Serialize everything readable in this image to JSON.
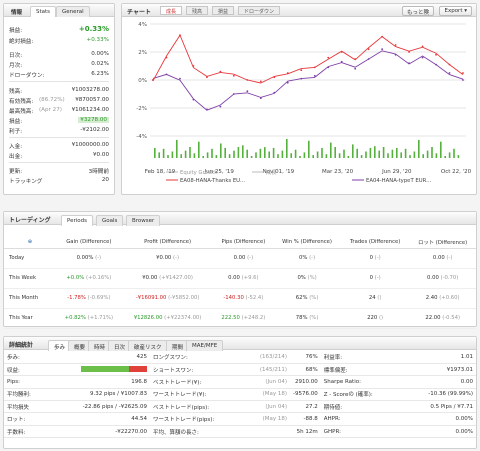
{
  "info": {
    "tabs": [
      "情報",
      "Stats",
      "General"
    ],
    "rows": [
      {
        "k": "損益:",
        "v": "+0.33%",
        "cls": "green big"
      },
      {
        "k": "絶対損益:",
        "v": "+0.33%",
        "cls": "green"
      },
      {
        "k": "日次:",
        "v": "0.00%"
      },
      {
        "k": "月次:",
        "v": "0.02%"
      },
      {
        "k": "ドローダウン:",
        "v": "6.23%"
      },
      {
        "k": "残高:",
        "v": "¥1003278.00"
      },
      {
        "k": "有効残高:",
        "sub": "(86.72%)",
        "v": "¥870057.00"
      },
      {
        "k": "最高残高:",
        "sub": "(Apr 27)",
        "v": "¥1061234.00"
      },
      {
        "k": "損益:",
        "v": "¥3278.00",
        "cls": "hl"
      },
      {
        "k": "利子:",
        "v": "-¥2102.00"
      },
      {
        "k": "入金:",
        "v": "¥1000000.00"
      },
      {
        "k": "出金:",
        "v": "¥0.00"
      },
      {
        "k": "更新:",
        "v": "3時間前"
      },
      {
        "k": "トラッキング",
        "v": "20"
      }
    ]
  },
  "chart": {
    "title": "チャート",
    "tabs": [
      "成長",
      "残高",
      "損益",
      "ドローダウン"
    ],
    "more": "もっと険",
    "export": "Export",
    "legend": [
      "Equity Growth",
      "成長",
      "EA08-HANA-Thanks EU...",
      "EA04-HANA-typeT EUR..."
    ],
    "colors": {
      "series1": "#7e3fa8",
      "series2": "#e8373a",
      "bars": "#55b03e"
    }
  },
  "chart_data": {
    "type": "line",
    "x": [
      "Feb 18, '19",
      "Jun 25, '19",
      "Nov 01, '19",
      "Mar 23, '20",
      "Jun 29, '20",
      "Oct 22, '20"
    ],
    "ylim": [
      -4,
      4
    ],
    "yticks": [
      "4%",
      "2%",
      "0%",
      "-2%",
      "-4%"
    ],
    "series": [
      {
        "name": "EA04-HANA-typeT EUR",
        "values": [
          0.0,
          0.4,
          0.1,
          -1.4,
          -2.1,
          -1.9,
          -1.0,
          -0.8,
          -1.3,
          -0.9,
          -0.2,
          0.1,
          0.3,
          0.9,
          1.3,
          0.8,
          1.5,
          2.2,
          1.8,
          1.2,
          1.6,
          1.1,
          0.5,
          0.0
        ]
      },
      {
        "name": "EA08-HANA-Thanks EU",
        "values": [
          0.0,
          1.6,
          3.2,
          1.0,
          0.2,
          0.6,
          0.3,
          0.0,
          -0.1,
          0.2,
          0.5,
          0.7,
          0.9,
          1.6,
          2.0,
          1.5,
          2.2,
          3.1,
          2.5,
          2.0,
          2.4,
          1.8,
          1.1,
          0.5
        ]
      }
    ]
  },
  "trading": {
    "title": "トレーディング",
    "tabs": [
      "Periods",
      "Goals",
      "Browser"
    ],
    "headers": [
      "Gain (Difference)",
      "Profit (Difference)",
      "Pips (Difference)",
      "Win % (Difference)",
      "Trades (Difference)",
      "ロット (Difference)"
    ],
    "rows": [
      {
        "name": "Today",
        "gain": "0.00%",
        "gain_d": "(-)",
        "profit": "¥0.00",
        "profit_d": "(-)",
        "pips": "0.00",
        "pips_d": "(-)",
        "win": "0%",
        "win_d": "(-)",
        "trades": "0",
        "trades_d": "(-)",
        "lots": "0.00",
        "lots_d": "(-)"
      },
      {
        "name": "This Week",
        "gain": "+0.0%",
        "gain_d": "(+0.16%)",
        "profit": "¥0.00",
        "profit_d": "(+¥1427.00)",
        "pips": "0.00",
        "pips_d": "(+9.6)",
        "win": "0%",
        "win_d": "(%)",
        "trades": "0",
        "trades_d": "(-)",
        "lots": "0.00",
        "lots_d": "(-0.70)"
      },
      {
        "name": "This Month",
        "gain": "-1.78%",
        "gain_d": "(-0.69%)",
        "profit": "-¥16091.00",
        "profit_d": "(-¥5852.00)",
        "pips": "-140.30",
        "pips_d": "(-52.4)",
        "win": "62%",
        "win_d": "(%)",
        "trades": "24",
        "trades_d": "()",
        "lots": "2.40",
        "lots_d": "(+0.60)"
      },
      {
        "name": "This Year",
        "gain": "+0.82%",
        "gain_d": "(+1.71%)",
        "profit": "¥12826.00",
        "profit_d": "(+¥22374.00)",
        "pips": "222.50",
        "pips_d": "(+248.2)",
        "win": "78%",
        "win_d": "(%)",
        "trades": "220",
        "trades_d": "()",
        "lots": "22.00",
        "lots_d": "(-0.54)"
      }
    ]
  },
  "stats": {
    "title": "詳細統計",
    "tabs": [
      "歩み",
      "概要",
      "時時",
      "日次",
      "破産リスク",
      "期間",
      "MAE/MFE"
    ],
    "col1": [
      {
        "k": "歩み:",
        "v": "425"
      },
      {
        "k": "収益:",
        "bar": true,
        "v": ""
      },
      {
        "k": "Pips:",
        "v": "196.8"
      },
      {
        "k": "平均勝利:",
        "v": "9.32 pips / ¥1007.83"
      },
      {
        "k": "平均損失",
        "v": "-22.86 pips / -¥2625.09"
      },
      {
        "k": "ロット:",
        "v": "44.54"
      },
      {
        "k": "手数料:",
        "v": "-¥22270.00"
      }
    ],
    "col2": [
      {
        "k": "ロングスワン:",
        "s": "(163/214)",
        "v": "76%"
      },
      {
        "k": "ショートスワン:",
        "s": "(145/211)",
        "v": "68%"
      },
      {
        "k": "ベストトレード(¥):",
        "s": "(Jun 04)",
        "v": "2910.00"
      },
      {
        "k": "ワーストトレード(¥):",
        "s": "(May 18)",
        "v": "-9576.00"
      },
      {
        "k": "ベストトレード(pips):",
        "s": "(Jun 04)",
        "v": "27.2"
      },
      {
        "k": "ワーストトレード(pips):",
        "s": "(May 18)",
        "v": "-88.8"
      },
      {
        "k": "平均、算額の長さ:",
        "s": "",
        "v": "5h 12m"
      }
    ],
    "col3": [
      {
        "k": "利益率:",
        "v": "1.01"
      },
      {
        "k": "標準偏差:",
        "v": "¥1973.01"
      },
      {
        "k": "Sharpe Ratio:",
        "v": "0.00"
      },
      {
        "k": "Z - Scoreの (確率):",
        "v": "-10.36 (99.99%)"
      },
      {
        "k": "期待値:",
        "v": "0.5 Pips / ¥7.71"
      },
      {
        "k": "AHPR:",
        "v": "0.00%"
      },
      {
        "k": "GHPR:",
        "v": "0.00%"
      }
    ],
    "bar_colors": {
      "win": "#6cc04a",
      "loss": "#e0413a"
    },
    "win_fraction": 0.72
  }
}
